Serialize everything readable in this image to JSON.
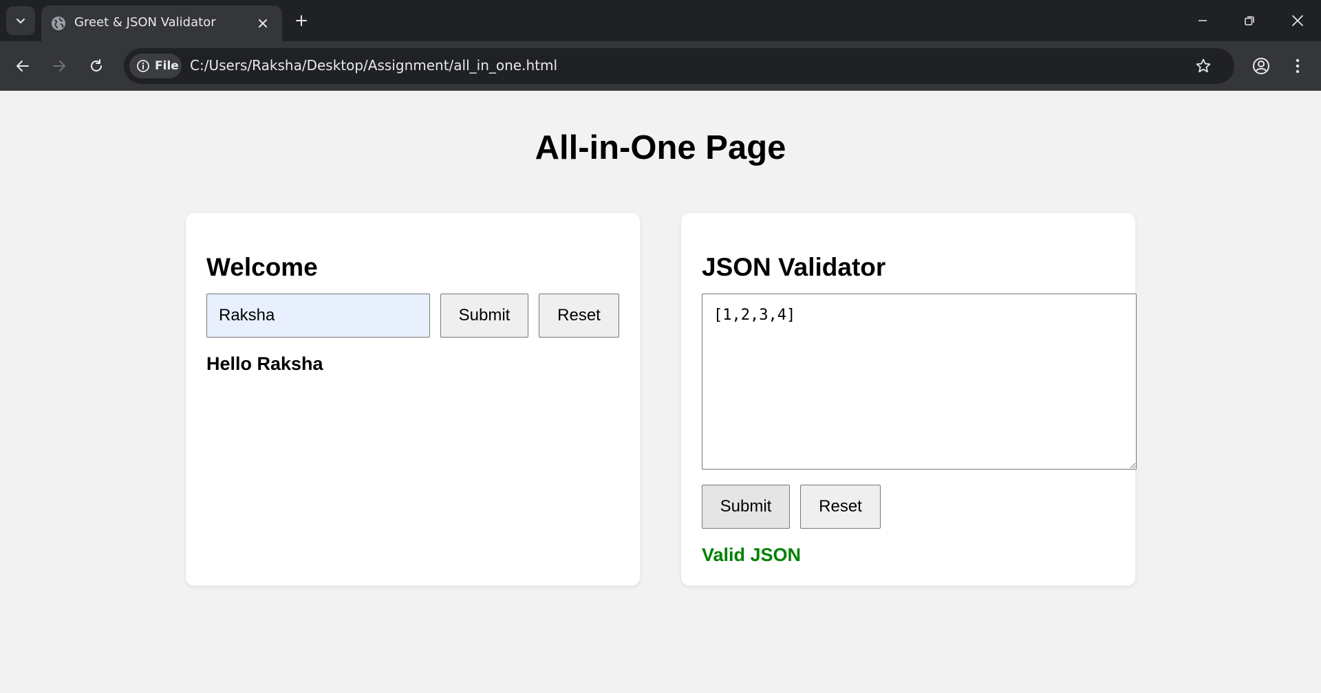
{
  "browser": {
    "tab_title": "Greet & JSON Validator",
    "omnibox": {
      "scheme_chip": "File",
      "url": "C:/Users/Raksha/Desktop/Assignment/all_in_one.html"
    },
    "icons": [
      "tab-search-icon",
      "globe-icon",
      "close-icon",
      "plus-icon",
      "minimize-icon",
      "restore-icon",
      "close-window-icon",
      "back-arrow-icon",
      "forward-arrow-icon",
      "reload-icon",
      "info-icon",
      "star-icon",
      "profile-icon",
      "kebab-menu-icon"
    ],
    "colors": {
      "tabstrip": "#202124",
      "toolbar": "#35363a",
      "omnibox": "#202124"
    }
  },
  "page": {
    "title": "All-in-One Page",
    "background": "#f2f2f2"
  },
  "greet_card": {
    "heading": "Welcome",
    "name_input_value": "Raksha",
    "submit_label": "Submit",
    "reset_label": "Reset",
    "greeting": "Hello Raksha"
  },
  "json_card": {
    "heading": "JSON Validator",
    "textarea_value": "[1,2,3,4]",
    "submit_label": "Submit",
    "reset_label": "Reset",
    "status": "Valid JSON",
    "status_color": "#008000"
  }
}
